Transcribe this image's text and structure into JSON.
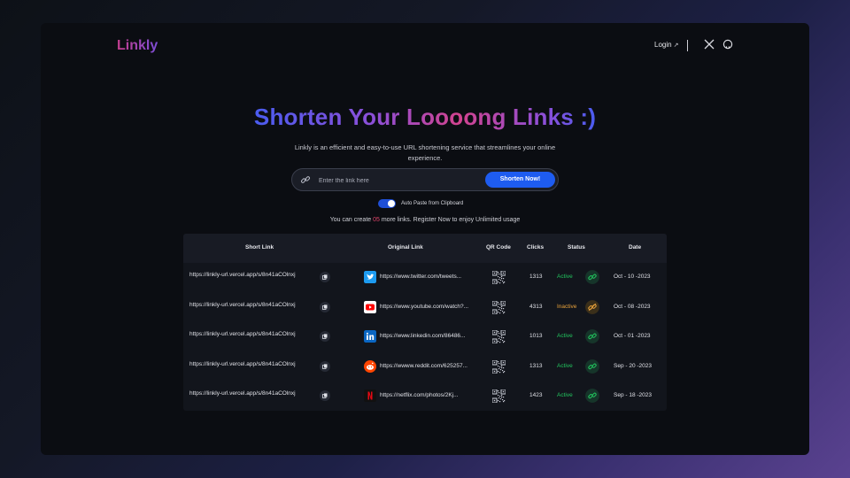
{
  "header": {
    "logo": "Linkly",
    "login_label": "Login",
    "login_arrow": "↗",
    "icons": [
      "x-icon",
      "github-icon"
    ]
  },
  "hero": {
    "title": "Shorten Your Loooong Links :)",
    "subtitle": "Linkly is an efficient and easy-to-use URL shortening service that streamlines your online experience."
  },
  "search": {
    "placeholder": "Enter the link here",
    "value": "",
    "button_label": "Shorten Now!"
  },
  "auto_paste": {
    "label": "Auto Paste from Clipboard",
    "enabled": true
  },
  "info": {
    "prefix": "You can create ",
    "count": "05",
    "suffix": " more links. Register Now to enjoy Unlimited usage"
  },
  "table": {
    "columns": [
      "Short Link",
      "Original Link",
      "QR Code",
      "Clicks",
      "Status",
      "Date"
    ],
    "rows": [
      {
        "short": "https://linkly-url.vercel.app/s/8n41aCOlnxj",
        "icon": "twitter-icon",
        "original": "https://www.twitter.com/tweets...",
        "clicks": "1313",
        "status": "Active",
        "date": "Oct - 10 -2023"
      },
      {
        "short": "https://linkly-url.vercel.app/s/8n41aCOlnxj",
        "icon": "youtube-icon",
        "original": "https://www.youtube.com/watch?...",
        "clicks": "4313",
        "status": "Inactive",
        "date": "Oct - 08 -2023"
      },
      {
        "short": "https://linkly-url.vercel.app/s/8n41aCOlnxj",
        "icon": "linkedin-icon",
        "original": "https://www.linkedin.com/86486...",
        "clicks": "1013",
        "status": "Active",
        "date": "Oct - 01 -2023"
      },
      {
        "short": "https://linkly-url.vercel.app/s/8n41aCOlnxj",
        "icon": "reddit-icon",
        "original": "https://wwww.reddit.com/625257...",
        "clicks": "1313",
        "status": "Active",
        "date": "Sep - 20 -2023"
      },
      {
        "short": "https://linkly-url.vercel.app/s/8n41aCOlnxj",
        "icon": "netflix-icon",
        "original": "https://netflix.com/photos/2Kj...",
        "clicks": "1423",
        "status": "Active",
        "date": "Sep - 18 -2023"
      }
    ]
  },
  "colors": {
    "accent_blue": "#1e5cf0",
    "active_green": "#22c55e",
    "inactive_orange": "#e9a23b",
    "count_red": "#e0456b"
  }
}
